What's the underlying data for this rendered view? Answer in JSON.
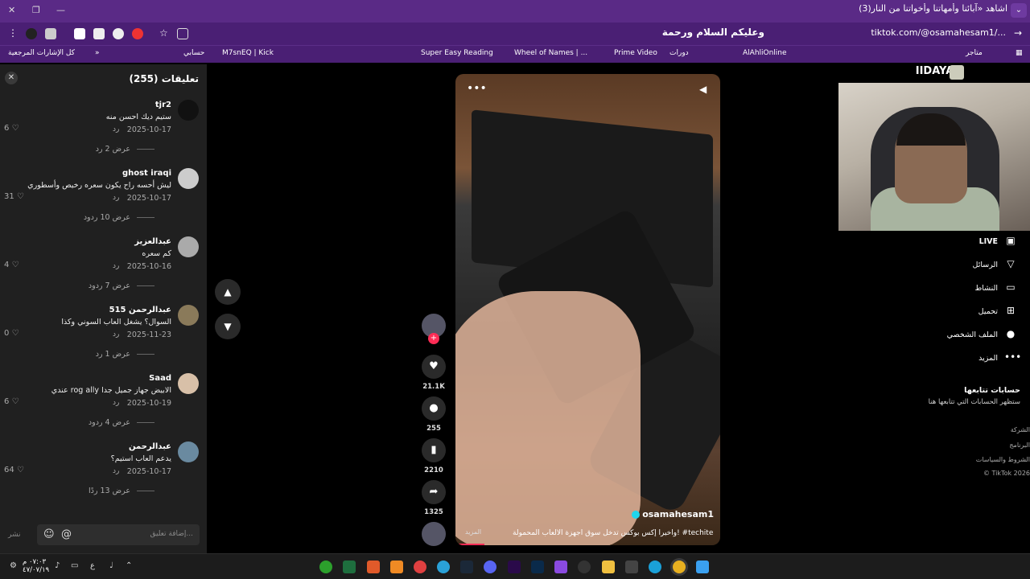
{
  "browser": {
    "tab_title": "(3)اشاهد «آبائنا وأمهاتنا وأخواتنا من النار",
    "url": "tiktok.com/@osamahesam1/...",
    "address_overlay": "وعليكم السلام ورحمة",
    "bookmarks": [
      "كل الإشارات المرجعية",
      "حسابي",
      "M7snEQ | Kick",
      "Super Easy Reading",
      "Wheel of Names | ...",
      "Prime Video",
      "دورات",
      "AlAhliOnline",
      "متاجر"
    ]
  },
  "comments_panel": {
    "header": "تعليقات (255)",
    "comments": [
      {
        "user": "tjr2",
        "text": "ستيم ديك احسن منه",
        "date": "2025-10-17",
        "reply": "رد",
        "likes": "6",
        "more": "عرض 2 رد"
      },
      {
        "user": "ghost iraqi",
        "text": "ليش أحسه راح يكون سعره رخيص وأسطوري",
        "date": "2025-10-17",
        "reply": "رد",
        "likes": "31",
        "more": "عرض 10 ردود"
      },
      {
        "user": "عبدالعزيز",
        "text": "كم سعره",
        "date": "2025-10-16",
        "reply": "رد",
        "likes": "4",
        "more": "عرض 7 ردود"
      },
      {
        "user": "عبدالرحمن 515",
        "text": "السوال؟ يشغل العاب السوني وكذا",
        "date": "2025-11-23",
        "reply": "رد",
        "likes": "0",
        "more": "عرض 1 رد"
      },
      {
        "user": "Saad",
        "text": "عندي rog ally الابيض جهاز جميل جدا",
        "date": "2025-10-19",
        "reply": "رد",
        "likes": "6",
        "more": "عرض 4 ردود"
      },
      {
        "user": "عبدالرحمن",
        "text": "يدعم العاب استيم؟",
        "date": "2025-10-17",
        "reply": "رد",
        "likes": "64",
        "more": "عرض 13 ردًا"
      }
    ],
    "input_placeholder": "إضافة تعليق...",
    "post_label": "نشر"
  },
  "video": {
    "author": "osamahesam1",
    "caption": "وأخيراً إكس بوكس تدخل سوق أجهزة الألعاب المحمولة! #techiteasy ...",
    "more_label": "المزيد",
    "progress": 0.11,
    "likes": "21.1K",
    "comments": "255",
    "saves": "2210",
    "shares": "1325"
  },
  "stream": {
    "title": "IIDAYA :"
  },
  "sidebar": {
    "items": [
      {
        "label": "LIVE",
        "icon": "live-icon"
      },
      {
        "label": "الرسائل",
        "icon": "send-icon"
      },
      {
        "label": "النشاط",
        "icon": "activity-icon"
      },
      {
        "label": "تحميل",
        "icon": "upload-icon"
      },
      {
        "label": "الملف الشخصي",
        "icon": "profile-icon"
      },
      {
        "label": "المزيد",
        "icon": "more-icon"
      }
    ],
    "following_title": "حسابات تتابعها",
    "following_sub": "ستظهر الحسابات التي تتابعها هنا",
    "footer": [
      "الشركة",
      "البرنامج",
      "الشروط والسياسات",
      "© TikTok 2026"
    ]
  },
  "taskbar": {
    "time": "٠٧:٠٣ م",
    "date": "٤٧/٠٧/١٩"
  },
  "colors": {
    "browser_purple": "#5a2a86",
    "tiktok_red": "#fe2c55",
    "verified_blue": "#20d5ec"
  }
}
